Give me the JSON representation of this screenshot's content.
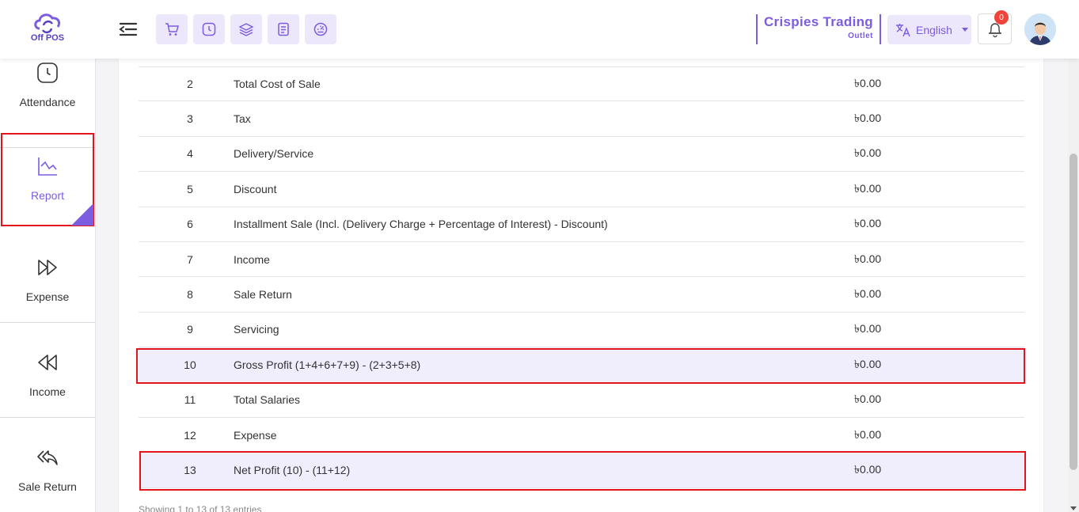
{
  "app": {
    "logo_text": "Off POS"
  },
  "header": {
    "outlet_name": "Crispies Trading",
    "outlet_sub": "Outlet",
    "language": "English",
    "notification_count": "0",
    "quick_icons": [
      "cart-icon",
      "clock-icon",
      "layers-icon",
      "receipt-icon",
      "dashboard-icon"
    ]
  },
  "sidebar": {
    "items": [
      {
        "label": "Attendance",
        "icon": "clock-icon"
      },
      {
        "label": "Report",
        "icon": "chart-icon",
        "active": true
      },
      {
        "label": "Expense",
        "icon": "forward-icon"
      },
      {
        "label": "Income",
        "icon": "rewind-icon"
      },
      {
        "label": "Sale Return",
        "icon": "reply-all-icon"
      }
    ]
  },
  "report": {
    "rows": [
      {
        "sn": "2",
        "desc": "Total Cost of Sale",
        "amount": "৳0.00"
      },
      {
        "sn": "3",
        "desc": "Tax",
        "amount": "৳0.00"
      },
      {
        "sn": "4",
        "desc": "Delivery/Service",
        "amount": "৳0.00"
      },
      {
        "sn": "5",
        "desc": "Discount",
        "amount": "৳0.00"
      },
      {
        "sn": "6",
        "desc": "Installment Sale (Incl. (Delivery Charge + Percentage of Interest) - Discount)",
        "amount": "৳0.00"
      },
      {
        "sn": "7",
        "desc": "Income",
        "amount": "৳0.00"
      },
      {
        "sn": "8",
        "desc": "Sale Return",
        "amount": "৳0.00"
      },
      {
        "sn": "9",
        "desc": "Servicing",
        "amount": "৳0.00"
      },
      {
        "sn": "10",
        "desc": "Gross Profit (1+4+6+7+9) - (2+3+5+8)",
        "amount": "৳0.00",
        "highlight": true
      },
      {
        "sn": "11",
        "desc": "Total Salaries",
        "amount": "৳0.00"
      },
      {
        "sn": "12",
        "desc": "Expense",
        "amount": "৳0.00"
      },
      {
        "sn": "13",
        "desc": "Net Profit (10) - (11+12)",
        "amount": "৳0.00",
        "highlight": true
      }
    ],
    "footer": "Showing 1 to 13 of 13 entries"
  },
  "colors": {
    "accent": "#7c5ce0",
    "highlight_border": "#e3141c",
    "highlight_bg": "#f0edfc",
    "badge": "#f0443a"
  }
}
